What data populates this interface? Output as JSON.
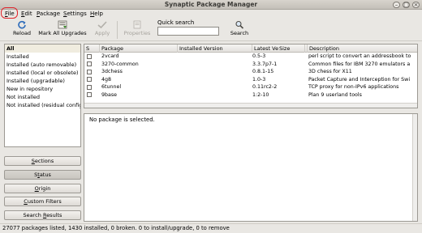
{
  "window": {
    "title": "Synaptic Package Manager"
  },
  "menubar": {
    "items": [
      {
        "label": "File",
        "mnemonic": "F",
        "rest": "ile"
      },
      {
        "label": "Edit",
        "mnemonic": "E",
        "rest": "dit"
      },
      {
        "label": "Package",
        "mnemonic": "P",
        "rest": "ackage"
      },
      {
        "label": "Settings",
        "mnemonic": "S",
        "rest": "ettings"
      },
      {
        "label": "Help",
        "mnemonic": "H",
        "rest": "elp"
      }
    ]
  },
  "toolbar": {
    "reload": "Reload",
    "mark_all_upgrades": "Mark All Upgrades",
    "apply": "Apply",
    "properties": "Properties",
    "quick_search_label": "Quick search",
    "quick_search_value": "",
    "search": "Search"
  },
  "filters": {
    "items": [
      "All",
      "Installed",
      "Installed (auto removable)",
      "Installed (local or obsolete)",
      "Installed (upgradable)",
      "New in repository",
      "Not installed",
      "Not installed (residual config)"
    ],
    "selected": "All"
  },
  "left_buttons": {
    "sections": {
      "pre": "",
      "mn": "S",
      "post": "ections"
    },
    "status": {
      "pre": "S",
      "mn": "t",
      "post": "atus"
    },
    "origin": {
      "pre": "",
      "mn": "O",
      "post": "rigin"
    },
    "custom_filters": {
      "pre": "",
      "mn": "C",
      "post": "ustom Filters"
    },
    "search_results": {
      "pre": "Search ",
      "mn": "R",
      "post": "esults"
    }
  },
  "table": {
    "columns": [
      "S",
      "Package",
      "Installed Version",
      "Latest Version",
      "Size",
      "Description"
    ],
    "rows": [
      {
        "package": "2vcard",
        "installed": "",
        "latest": "0.5-3",
        "size": "",
        "description": "perl script to convert an addressbook to"
      },
      {
        "package": "3270-common",
        "installed": "",
        "latest": "3.3.7p7-1",
        "size": "",
        "description": "Common files for IBM 3270 emulators a"
      },
      {
        "package": "3dchess",
        "installed": "",
        "latest": "0.8.1-15",
        "size": "",
        "description": "3D chess for X11"
      },
      {
        "package": "4g8",
        "installed": "",
        "latest": "1.0-3",
        "size": "",
        "description": "Packet Capture and Interception for Swi"
      },
      {
        "package": "6tunnel",
        "installed": "",
        "latest": "0.11rc2-2",
        "size": "",
        "description": "TCP proxy for non-IPv6 applications"
      },
      {
        "package": "9base",
        "installed": "",
        "latest": "1:2-10",
        "size": "",
        "description": "Plan 9 userland tools"
      }
    ]
  },
  "details": {
    "message": "No package is selected."
  },
  "statusbar": {
    "text": "27077 packages listed, 1430 installed, 0 broken. 0 to install/upgrade, 0 to remove"
  },
  "colors": {
    "highlight": "#e0242b",
    "selected_row": "#f0ecdf"
  }
}
